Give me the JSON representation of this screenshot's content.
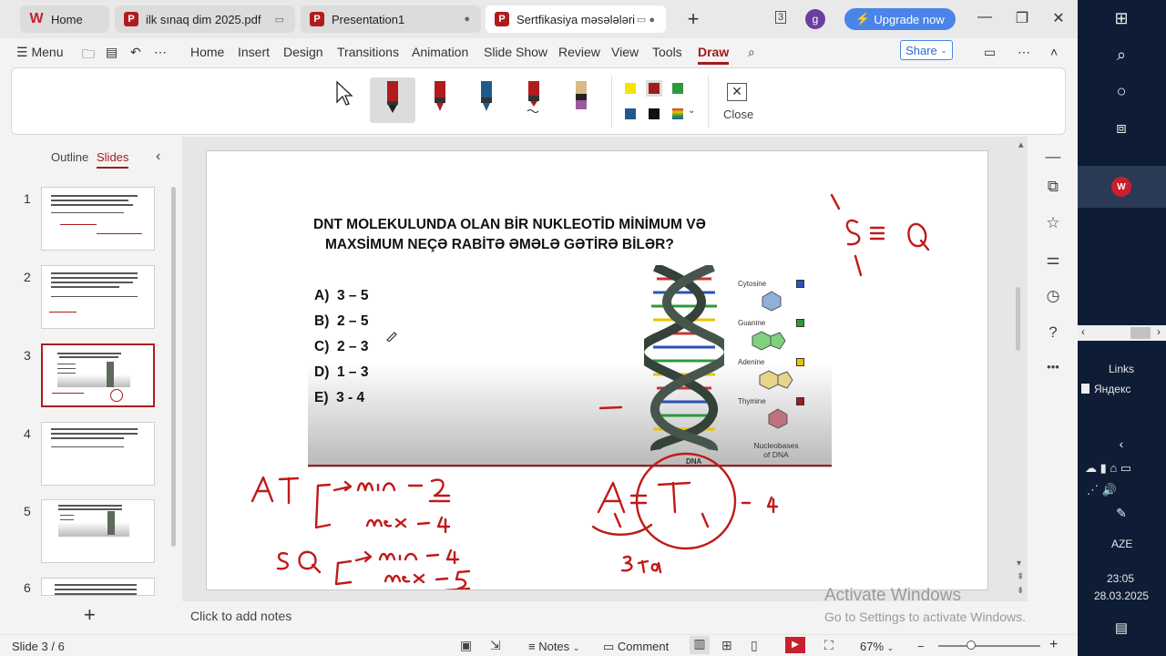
{
  "tabs": [
    {
      "label": "Home",
      "icon": "wps-writer-icon",
      "active": false
    },
    {
      "label": "ilk sınaq dim 2025.pdf",
      "icon": "pdf-icon",
      "active": false
    },
    {
      "label": "Presentation1",
      "icon": "presentation-icon",
      "active": false
    },
    {
      "label": "Sertfikasiya məsələləri",
      "icon": "presentation-icon",
      "active": true
    }
  ],
  "titlebar": {
    "tab_count": "3",
    "avatar_letter": "g",
    "upgrade_label": "Upgrade now",
    "colors": {
      "upgrade": "#4a84e8",
      "brand": "#b01c1c"
    }
  },
  "menu": {
    "menu_label": "Menu",
    "items": [
      "Home",
      "Insert",
      "Design",
      "Transitions",
      "Animation",
      "Slide Show",
      "Review",
      "View",
      "Tools",
      "Draw"
    ],
    "active": "Draw",
    "share_label": "Share"
  },
  "draw": {
    "pens": [
      {
        "name": "pen-red-selected",
        "color": "#b01c1c"
      },
      {
        "name": "pen-red",
        "color": "#b01c1c"
      },
      {
        "name": "pen-blue",
        "color": "#1f5a8c"
      },
      {
        "name": "pen-red-wavy",
        "color": "#b01c1c"
      },
      {
        "name": "highlighter-tan",
        "color": "#d8b987"
      }
    ],
    "swatches": [
      "#f5e300",
      "#a01c1c",
      "#2c9a3a",
      "#1f5a8c",
      "#111111",
      "multicolor"
    ],
    "close_label": "Close"
  },
  "left_panel": {
    "tabs": [
      "Outline",
      "Slides"
    ],
    "active_tab": "Slides",
    "slides": [
      "1",
      "2",
      "3",
      "4",
      "5",
      "6"
    ],
    "active_slide": "3"
  },
  "slide": {
    "title_line1": "DNT MOLEKULUNDA OLAN BİR NUKLEOTİD MİNİMUM VƏ",
    "title_line2": "MAXSİMUM NEÇƏ RABİTƏ ƏMƏLƏ GƏTİRƏ BİLƏR?",
    "options": [
      {
        "letter": "A)",
        "text": "3 – 5"
      },
      {
        "letter": "B)",
        "text": "2 – 5"
      },
      {
        "letter": "C)",
        "text": "2 – 3"
      },
      {
        "letter": "D)",
        "text": "1 – 3"
      },
      {
        "letter": "E)",
        "text": "3 - 4"
      }
    ],
    "nucleobases": [
      {
        "name": "Cytosine",
        "code": "C",
        "color": "#2a52b8"
      },
      {
        "name": "Guanine",
        "code": "G",
        "color": "#2c9a3a"
      },
      {
        "name": "Adenine",
        "code": "A",
        "color": "#d8b400"
      },
      {
        "name": "Thymine",
        "code": "T",
        "color": "#a01c1c"
      }
    ],
    "nucleobases_caption": "Nucleobases of DNA",
    "dna_label": "DNA",
    "handwriting": {
      "top_right": "S ≡ Q",
      "at_line1": "AT → min - 2",
      "at_line2": "max - 4",
      "sq_line1": "SQ → min - 4",
      "sq_line2": "max - 5",
      "circle_note": "A = T - 4",
      "circle_sub": "3 ta"
    }
  },
  "notes": {
    "placeholder": "Click to add notes"
  },
  "status": {
    "slide_counter": "Slide 3 / 6",
    "notes_label": "Notes",
    "comment_label": "Comment",
    "zoom": "67%"
  },
  "watermark": {
    "line1": "Activate Windows",
    "line2": "Go to Settings to activate Windows."
  },
  "taskbar": {
    "links_label": "Links",
    "yandex_label": "Яндекс",
    "lang": "AZE",
    "time": "23:05",
    "date": "28.03.2025"
  }
}
